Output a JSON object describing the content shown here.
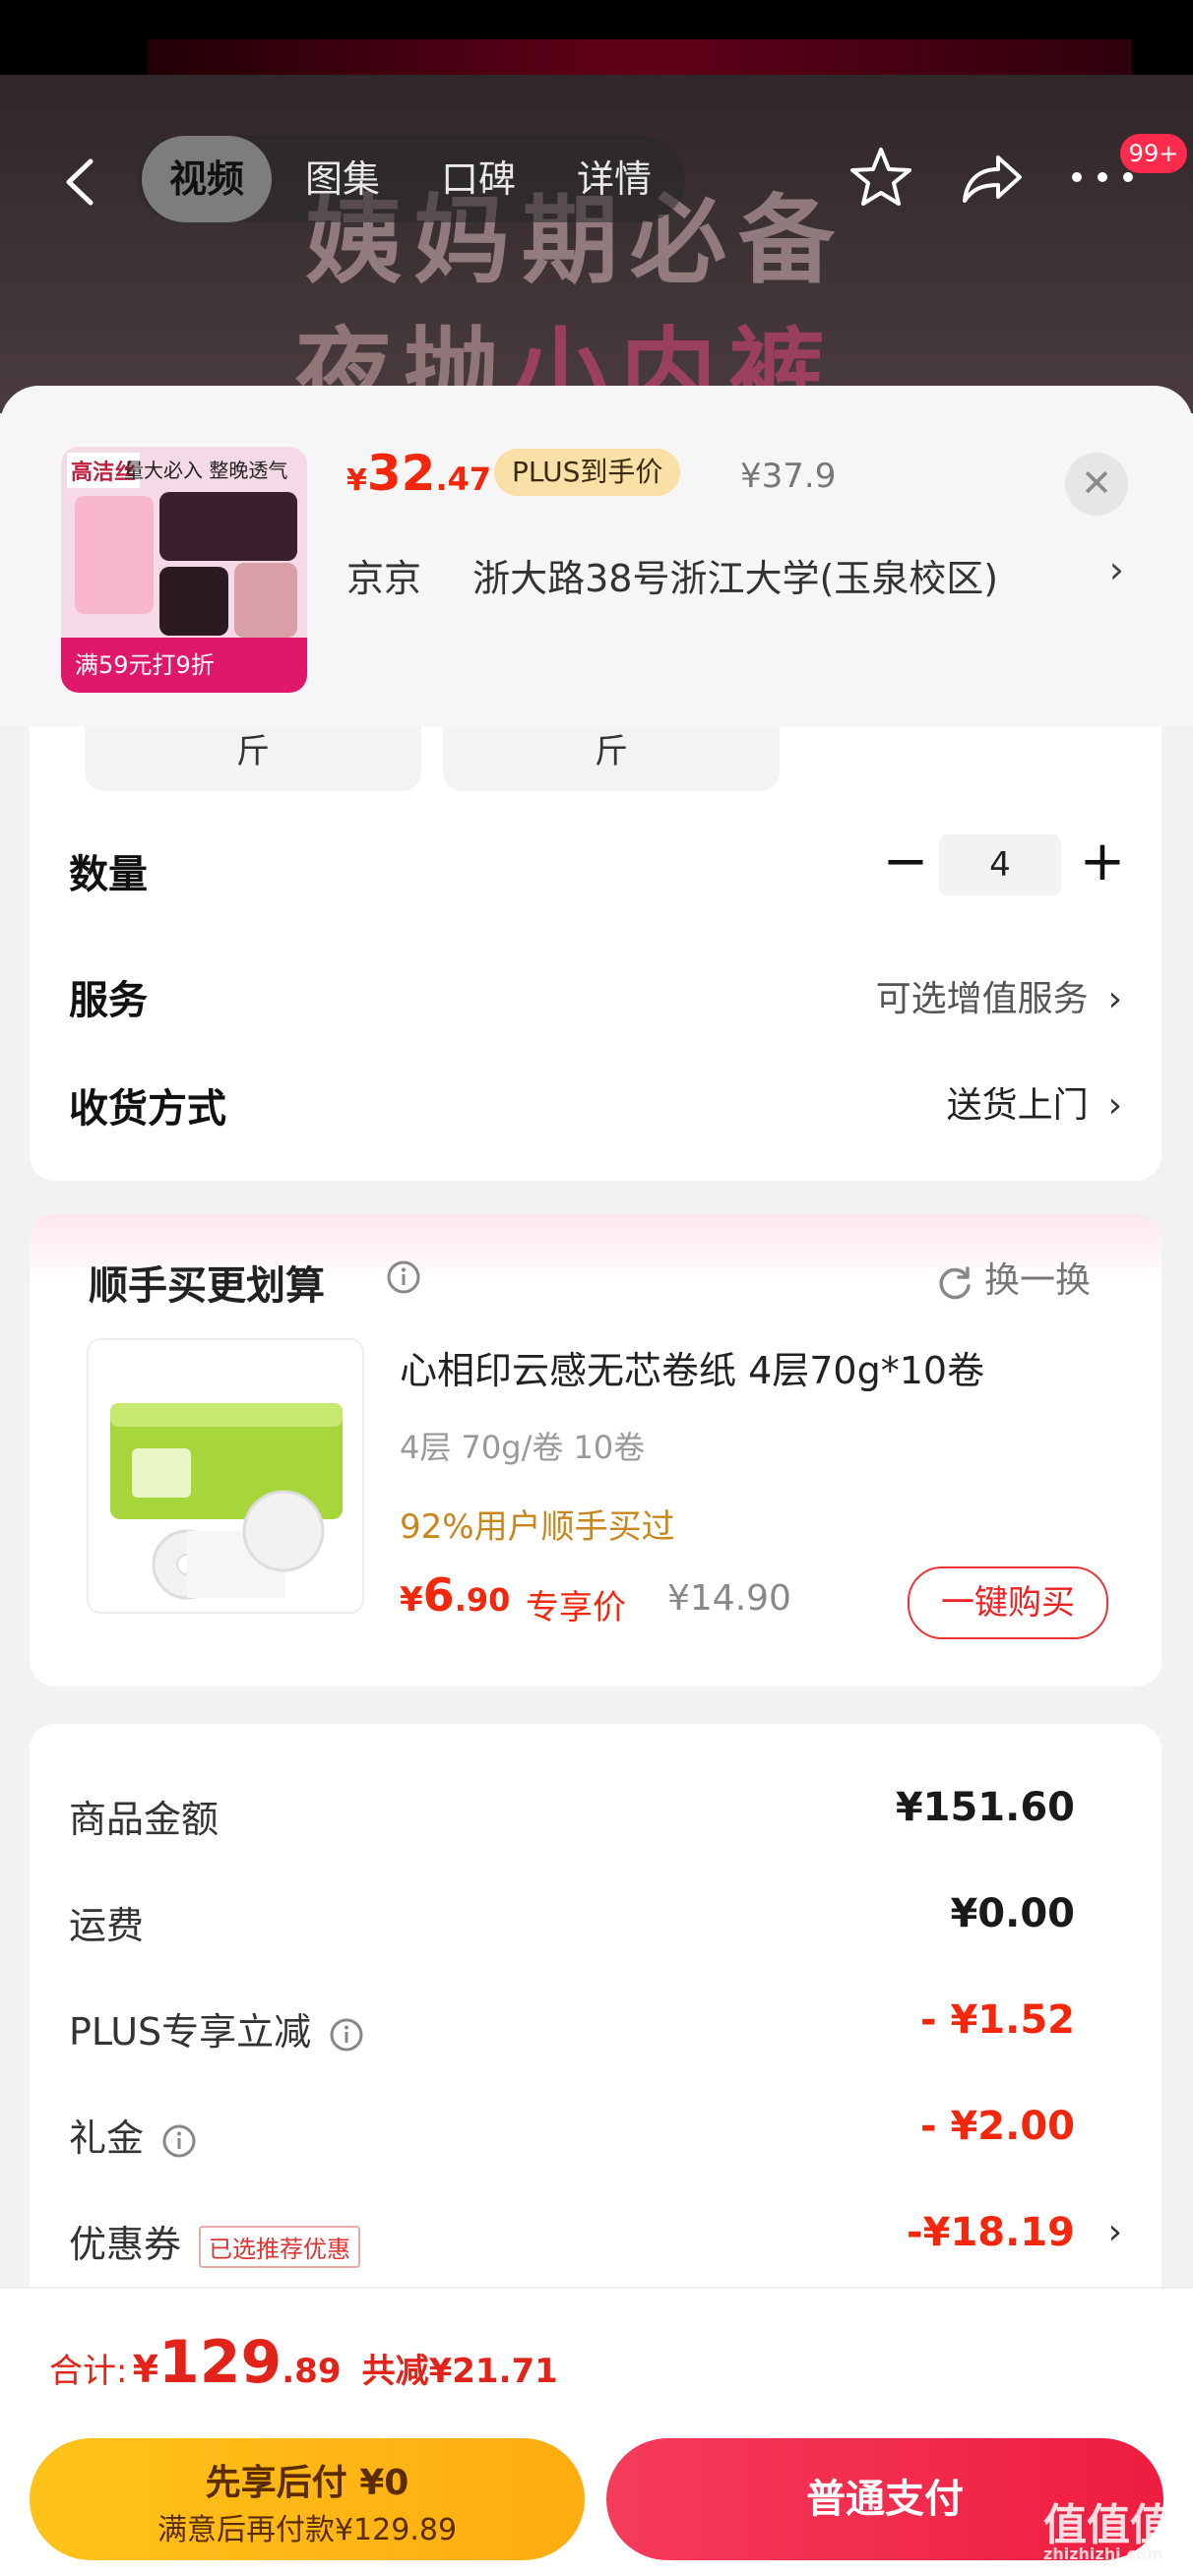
{
  "header": {
    "tabs": [
      {
        "label": "视频",
        "active": true
      },
      {
        "label": "图集",
        "active": false
      },
      {
        "label": "口碑",
        "active": false
      },
      {
        "label": "详情",
        "active": false
      }
    ],
    "badge": "99+",
    "bg_text_line1": "姨妈期必备",
    "bg_text_line2_a": "夜抛",
    "bg_text_line2_b": "小内裤"
  },
  "product": {
    "thumb_brand": "高洁丝",
    "thumb_slogan": "量大必入 整晚透气",
    "thumb_footer": "满59元打9折",
    "price_symbol": "¥",
    "price_int": "32",
    "price_dec": ".47",
    "plus_tag": "PLUS到手价",
    "orig_price": "¥37.9",
    "address_city": "京京",
    "address_detail": "浙大路38号浙江大学(玉泉校区)"
  },
  "options": {
    "spec_chips": [
      "斤",
      "斤"
    ],
    "quantity_label": "数量",
    "quantity_value": "4",
    "service_label": "服务",
    "service_value": "可选增值服务",
    "delivery_label": "收货方式",
    "delivery_value": "送货上门"
  },
  "bundle": {
    "title": "顺手买更划算",
    "swap_label": "换一换",
    "name": "心相印云感无芯卷纸 4层70g*10卷",
    "spec": "4层 70g/卷 10卷",
    "social": "92%用户顺手买过",
    "price_symbol": "¥",
    "price_int": "6",
    "price_dec": ".90",
    "price_tag": "专享价",
    "orig_price": "¥14.90",
    "buy_label": "一键购买"
  },
  "breakdown": {
    "rows": [
      {
        "label": "商品金额",
        "value": "¥151.60"
      },
      {
        "label": "运费",
        "value": "¥0.00"
      },
      {
        "label": "PLUS专享立减",
        "value": "- ¥1.52"
      },
      {
        "label": "礼金",
        "value": "- ¥2.00"
      },
      {
        "label": "优惠券",
        "value": "-¥18.19"
      }
    ],
    "coupon_tag": "已选推荐优惠"
  },
  "footer": {
    "total_label": "合计:",
    "total_symbol": "¥",
    "total_int": "129",
    "total_dec": ".89",
    "total_saving": "共减¥21.71",
    "paylater_title": "先享后付 ¥0",
    "paylater_sub": "满意后再付款¥129.89",
    "normal_pay": "普通支付",
    "watermark": "值值值",
    "watermark_sub": "zhizhizhi.com"
  },
  "colors": {
    "accent_red": "#f2270c",
    "plus_gold": "#f8e0a6",
    "paylater_yellow": "#ffc21a",
    "pay_red": "#ee1d3f"
  }
}
